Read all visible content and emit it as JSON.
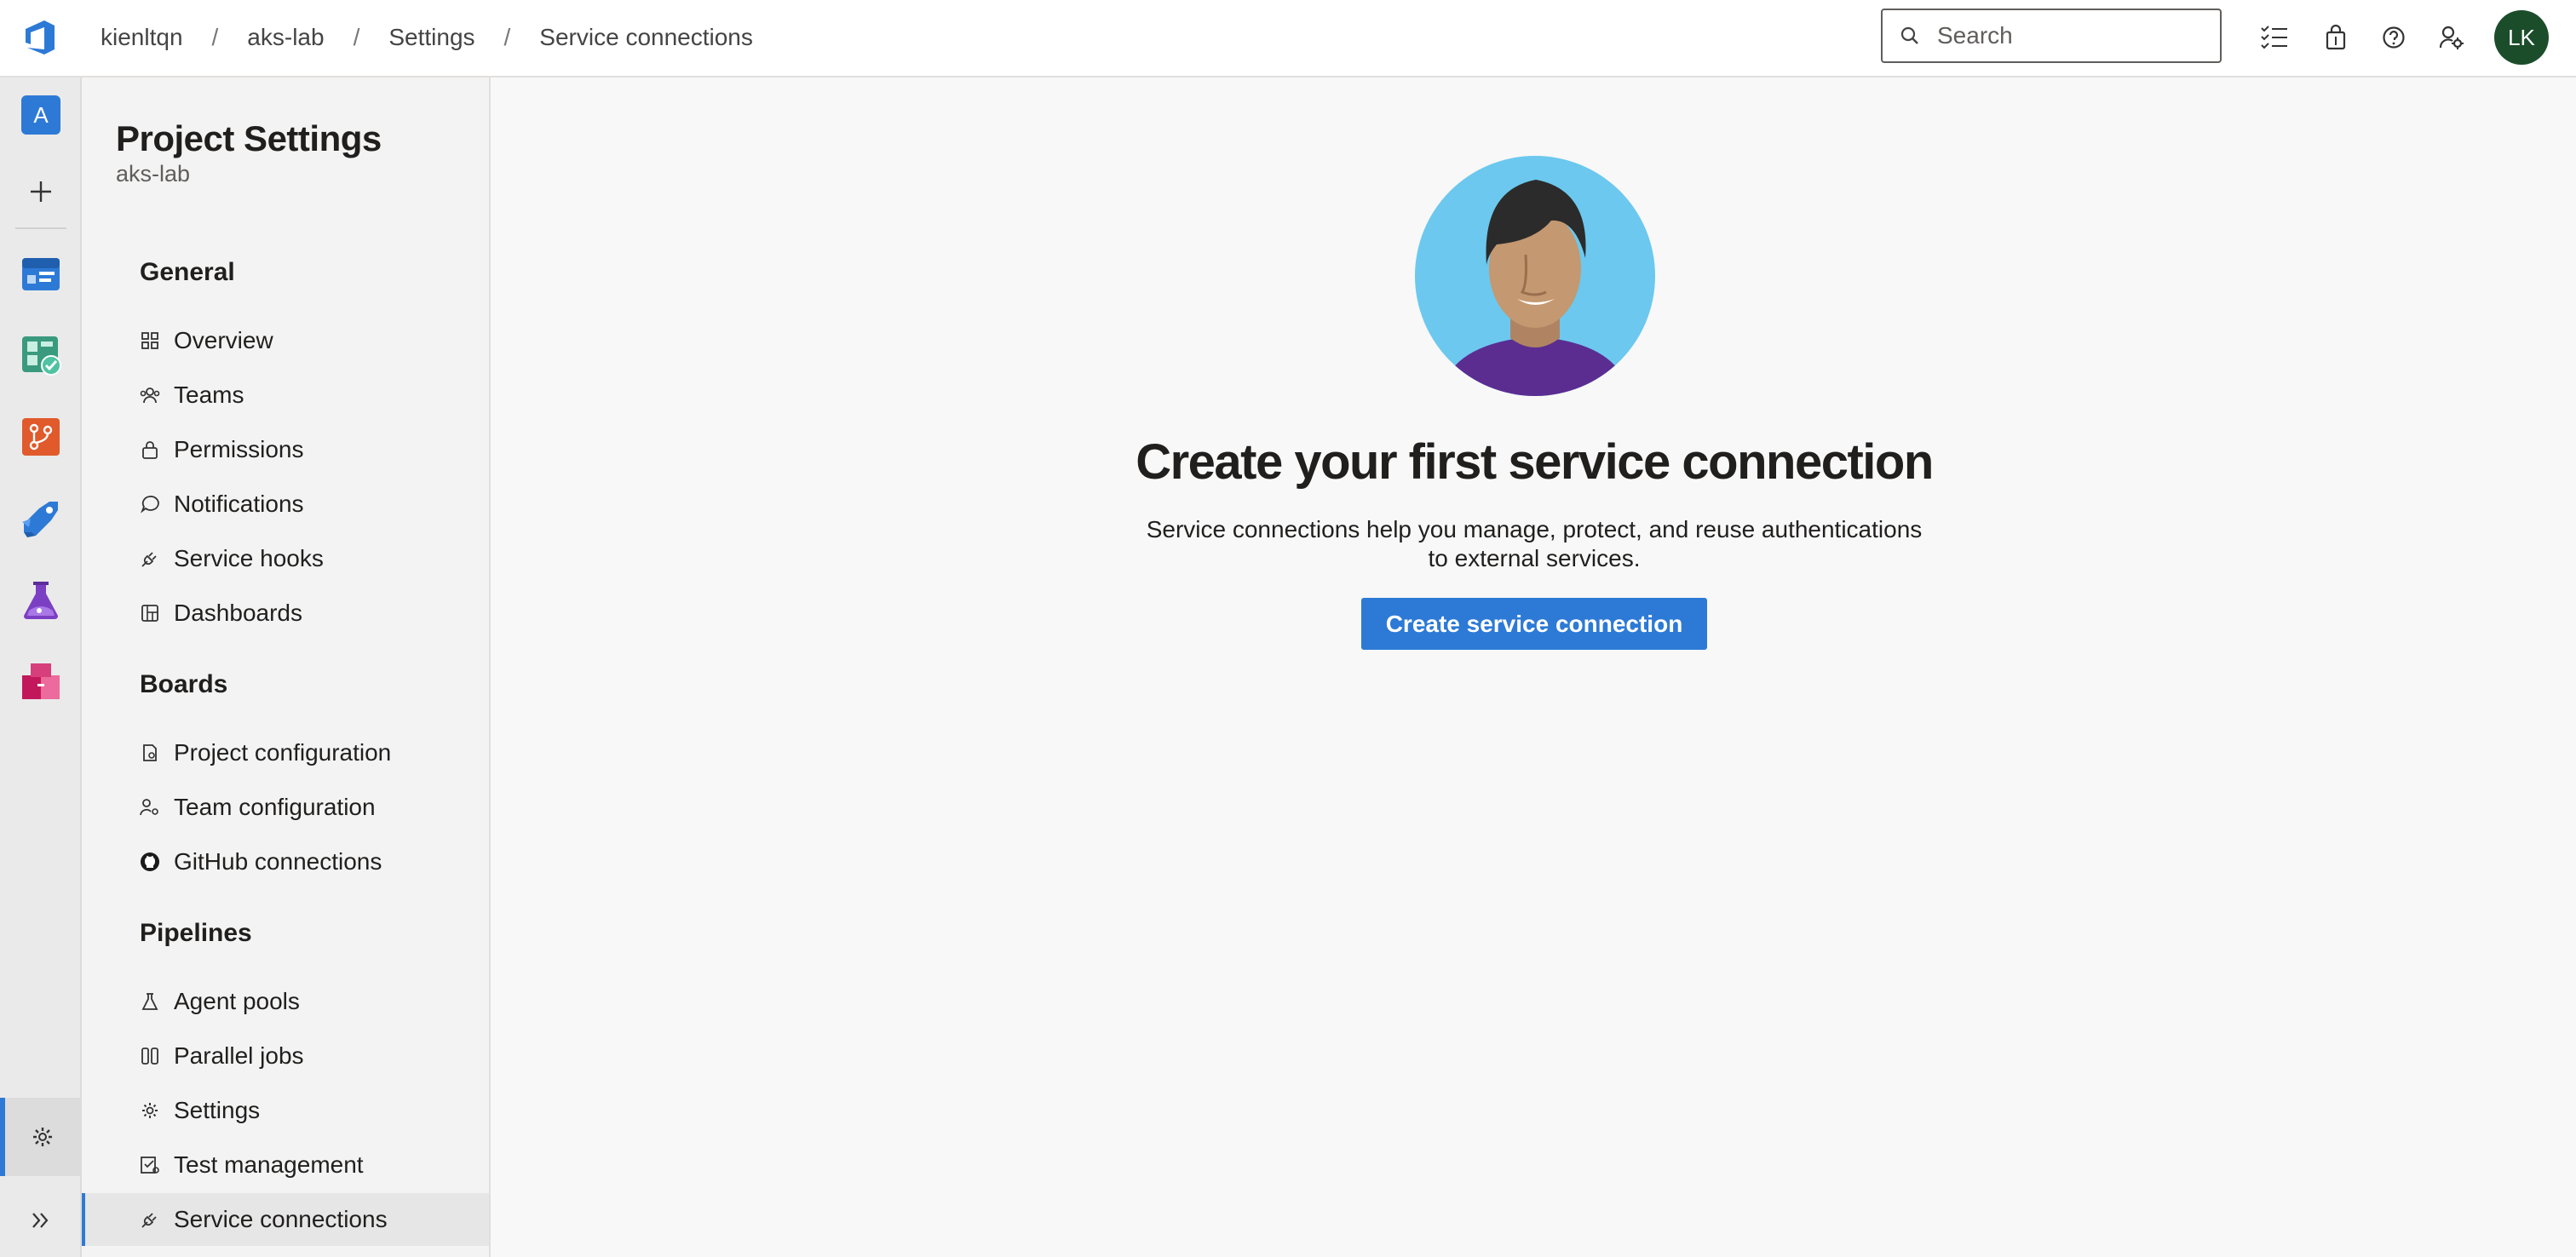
{
  "topbar": {
    "breadcrumbs": [
      "kienltqn",
      "aks-lab",
      "Settings",
      "Service connections"
    ],
    "separator": "/",
    "search_placeholder": "Search",
    "avatar_initials": "LK",
    "avatar_color": "#1c4d2b"
  },
  "rail": {
    "org_initial": "A",
    "items": [
      "overview-icon",
      "boards-icon",
      "repos-icon",
      "pipelines-icon",
      "test-plans-icon",
      "artifacts-icon"
    ],
    "accent": "#2d7ad6"
  },
  "nav": {
    "title": "Project Settings",
    "subtitle": "aks-lab",
    "sections": [
      {
        "title": "General",
        "items": [
          "Overview",
          "Teams",
          "Permissions",
          "Notifications",
          "Service hooks",
          "Dashboards"
        ]
      },
      {
        "title": "Boards",
        "items": [
          "Project configuration",
          "Team configuration",
          "GitHub connections"
        ]
      },
      {
        "title": "Pipelines",
        "items": [
          "Agent pools",
          "Parallel jobs",
          "Settings",
          "Test management",
          "Service connections"
        ]
      }
    ],
    "active_item": "Service connections"
  },
  "main": {
    "heading": "Create your first service connection",
    "desc_line1": "Service connections help you manage, protect, and reuse authentications",
    "desc_line2": "to external services.",
    "button": "Create service connection",
    "button_color": "#2d7ad6"
  }
}
